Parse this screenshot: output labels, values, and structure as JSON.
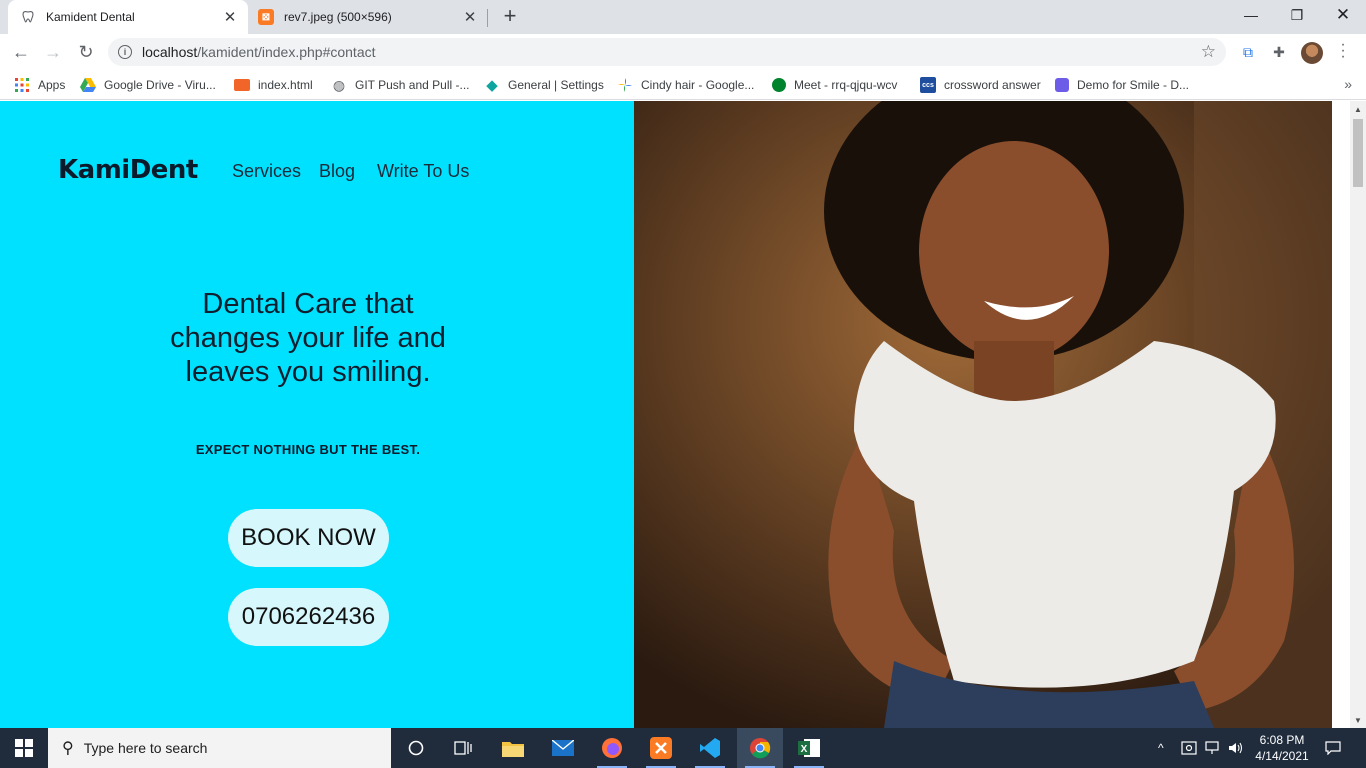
{
  "browser": {
    "tabs": [
      {
        "title": "Kamident Dental",
        "icon": "tooth-icon"
      },
      {
        "title": "rev7.jpeg (500×596)",
        "icon": "xampp-icon"
      }
    ],
    "url_host": "localhost",
    "url_path": "/kamident/index.php#contact",
    "bookmarks": [
      {
        "label": "Apps",
        "icon": "apps-grid-icon"
      },
      {
        "label": "Google Drive - Viru...",
        "icon": "google-drive-icon"
      },
      {
        "label": "index.html",
        "icon": "html-icon"
      },
      {
        "label": "GIT Push and Pull -...",
        "icon": "globe-icon"
      },
      {
        "label": "General | Settings",
        "icon": "diamond-icon"
      },
      {
        "label": "Cindy hair - Google...",
        "icon": "google-photos-icon"
      },
      {
        "label": "Meet - rrq-qjqu-wcv",
        "icon": "meet-icon"
      },
      {
        "label": "crossword answer",
        "icon": "ccs-icon"
      },
      {
        "label": "Demo for Smile - D...",
        "icon": "demo-icon"
      }
    ]
  },
  "page": {
    "logo": "KamiDent",
    "nav": [
      "Services",
      "Blog",
      "Write To Us"
    ],
    "hero_title": "Dental Care that changes your life and leaves you smiling.",
    "tagline": "EXPECT NOTHING BUT THE BEST.",
    "book_button": "BOOK NOW",
    "phone_button": "0706262436",
    "accent_color": "#00e1ff"
  },
  "taskbar": {
    "search_placeholder": "Type here to search",
    "time": "6:08 PM",
    "date": "4/14/2021"
  }
}
